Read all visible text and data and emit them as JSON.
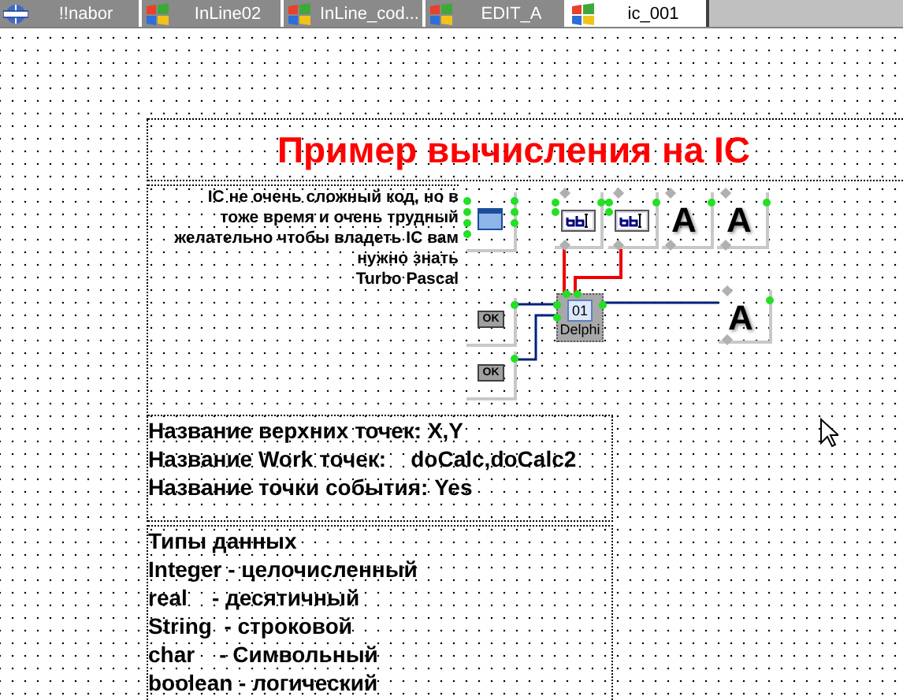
{
  "tabs": [
    {
      "label": "!!nabor",
      "kind": "web",
      "selected": false
    },
    {
      "label": "InLine02",
      "kind": "windows",
      "selected": false
    },
    {
      "label": "InLine_cod...",
      "kind": "windows",
      "selected": false
    },
    {
      "label": "EDIT_A",
      "kind": "windows",
      "selected": false
    },
    {
      "label": "ic_001",
      "kind": "windows",
      "selected": true
    }
  ],
  "title": "Пример вычисления на IC",
  "note_lines": [
    "IC не очень сложный код, но в",
    "тоже время и очень трудный",
    "желательно чтобы владеть IC вам",
    "нужно знать",
    "Turbo Pascal"
  ],
  "points_info": [
    "Название верхних точек: X,Y",
    "Название Work точек:    doCalc,doCalc2",
    "Название точки события: Yes"
  ],
  "data_types": [
    "Типы данных",
    "Integer - целочисленный",
    "real    - десятичный",
    "String  - строковой",
    "char    - Символьный",
    "boolean - логический"
  ],
  "components": [
    {
      "kind": "form"
    },
    {
      "kind": "edit"
    },
    {
      "kind": "edit"
    },
    {
      "kind": "label",
      "glyph": "A"
    },
    {
      "kind": "label",
      "glyph": "A"
    },
    {
      "kind": "button",
      "text": "OK"
    },
    {
      "kind": "code",
      "badge": "01",
      "text": "Delphi"
    },
    {
      "kind": "label",
      "glyph": "A"
    },
    {
      "kind": "button",
      "text": "OK"
    }
  ]
}
